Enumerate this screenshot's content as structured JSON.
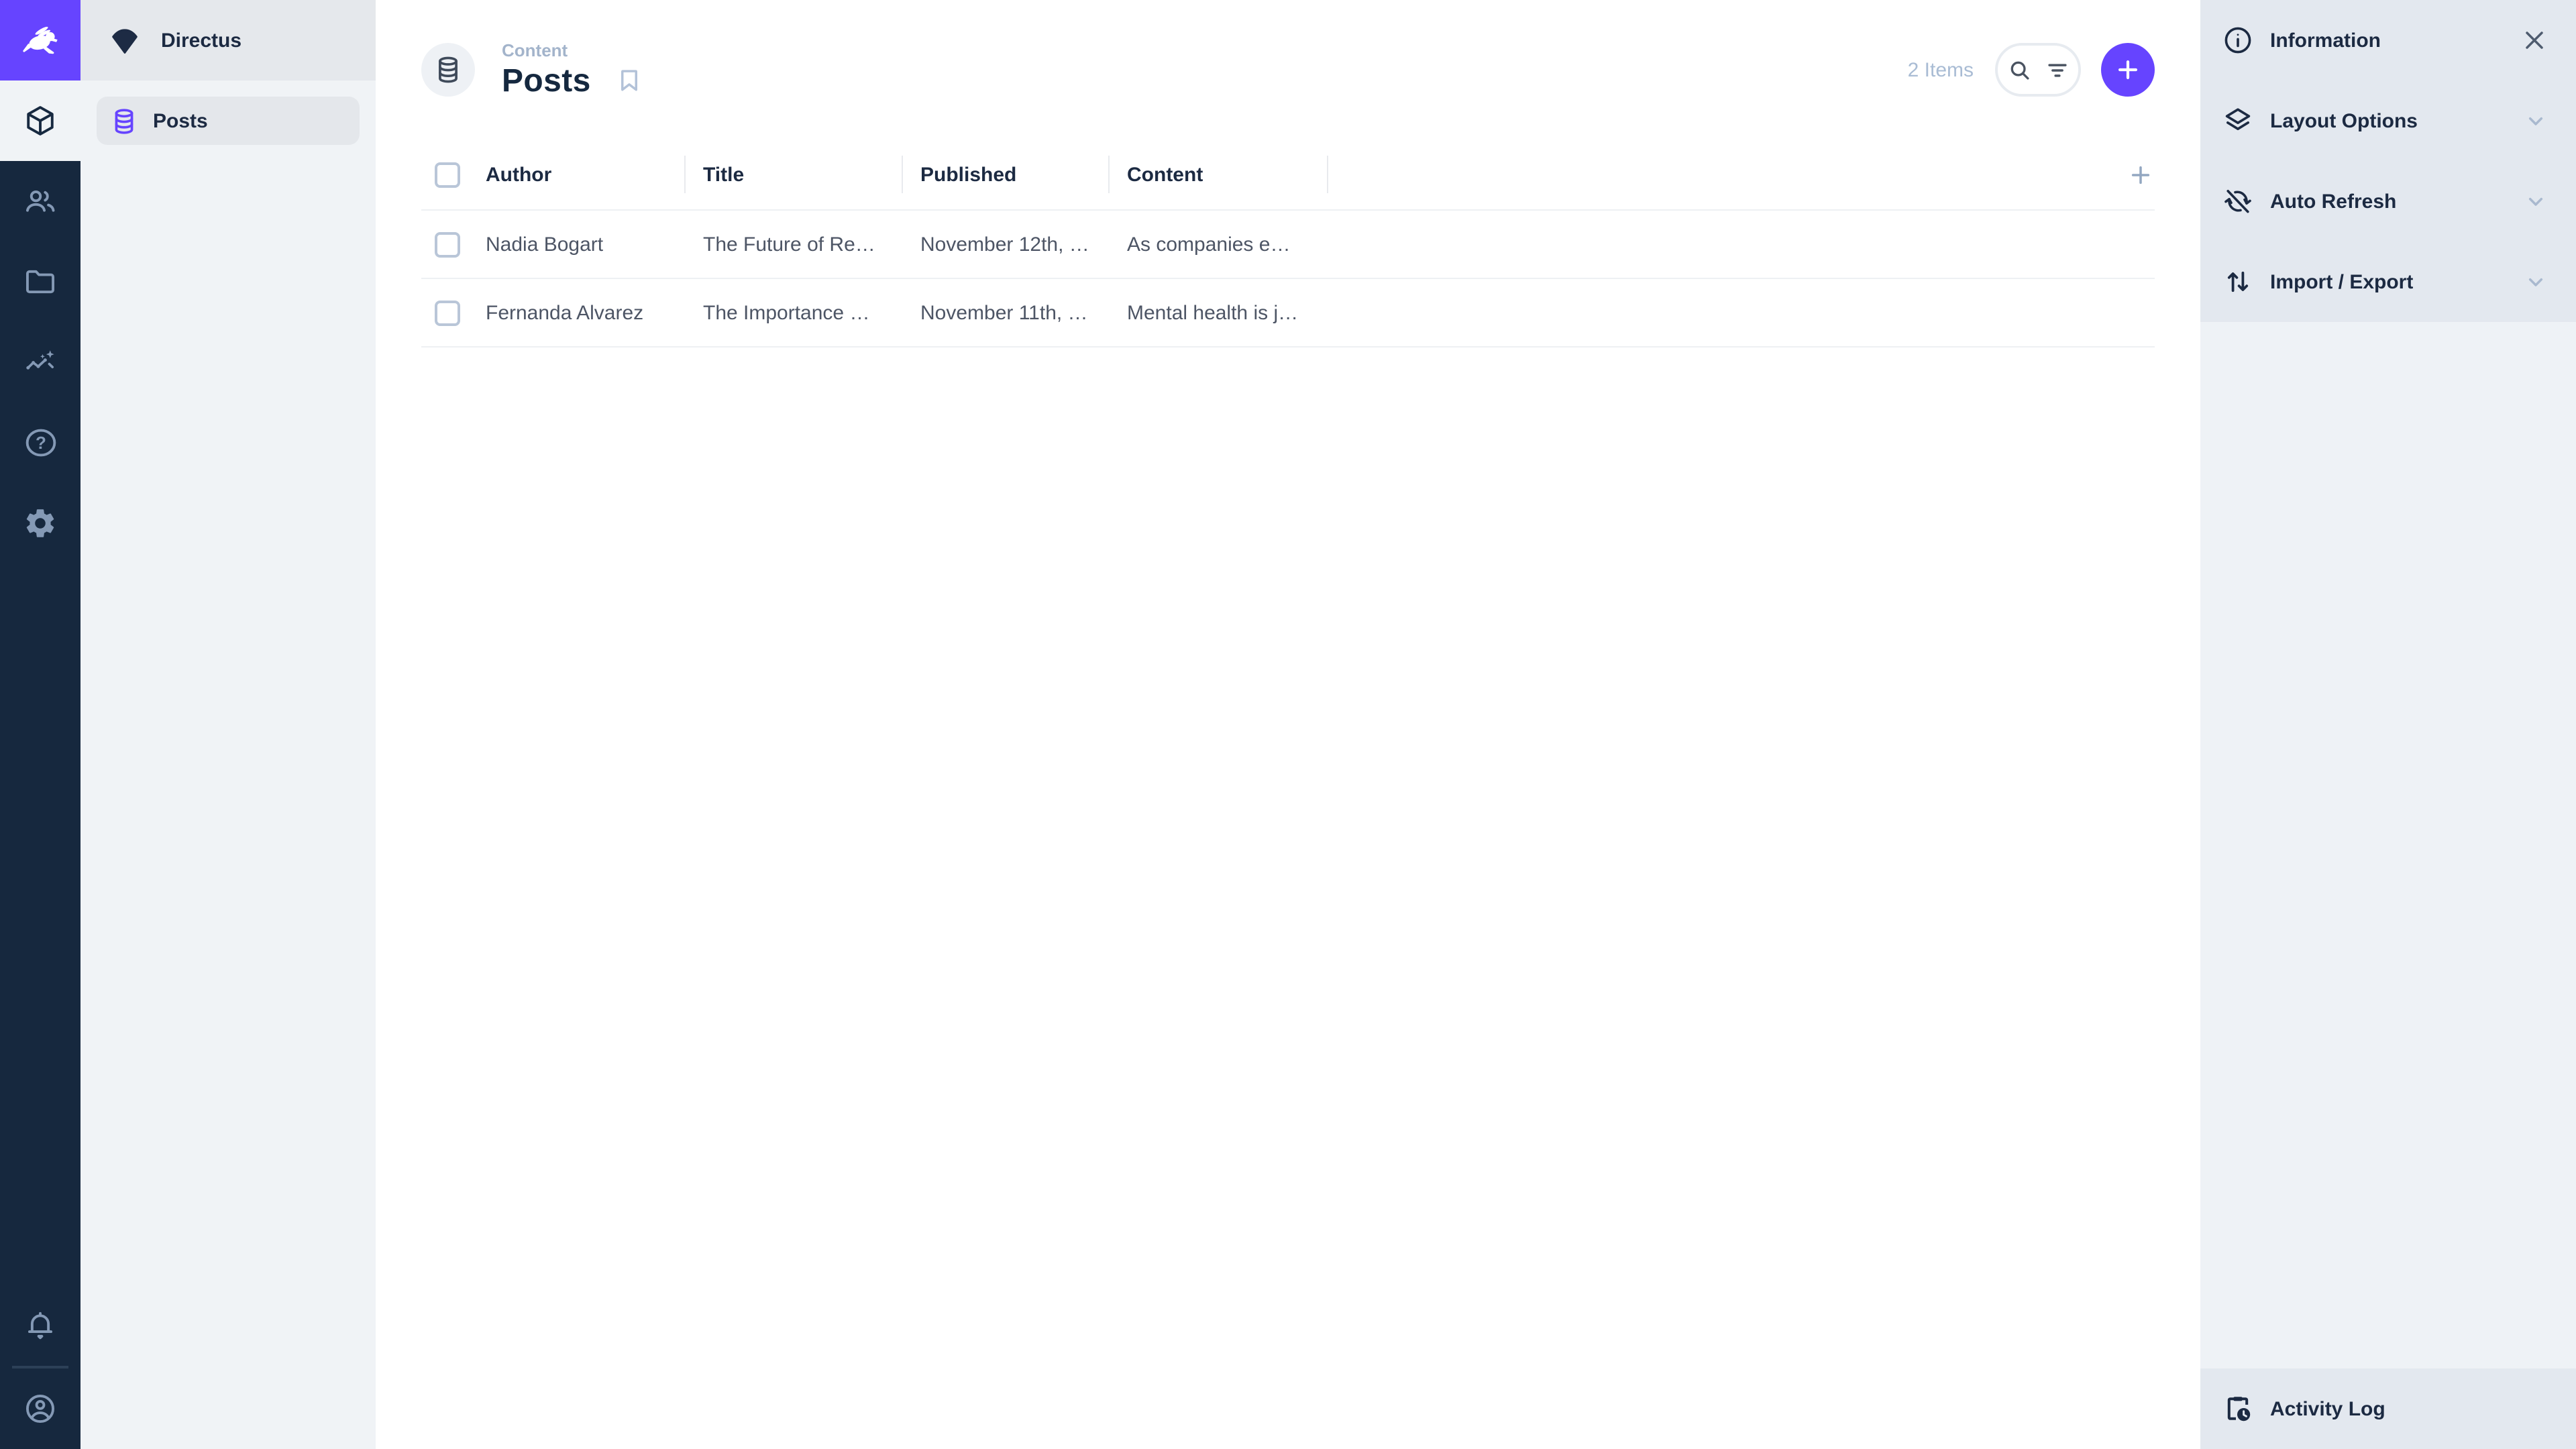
{
  "colors": {
    "brand_purple": "#6644ff",
    "module_bar_bg": "#16283e",
    "module_icon": "#8499b5",
    "nav_bg": "#f0f3f6",
    "nav_header_bg": "#e5e8ec",
    "nav_active_item_bg": "#e4e7eb",
    "sidebar_bg": "#eef2f6",
    "sidebar_section_bg": "#e3e8ef",
    "text_dark": "#1c2a42",
    "text_row": "#4d5565",
    "text_muted": "#a9bcd4",
    "row_divider": "#eef0f3"
  },
  "module_bar": {
    "logo_icon": "rabbit-logo",
    "modules": [
      {
        "name": "content",
        "icon": "box-icon",
        "active": true
      },
      {
        "name": "user-directory",
        "icon": "people-icon",
        "active": false
      },
      {
        "name": "file-library",
        "icon": "folder-icon",
        "active": false
      },
      {
        "name": "insights",
        "icon": "insights-icon",
        "active": false
      },
      {
        "name": "help",
        "icon": "help-icon",
        "active": false
      },
      {
        "name": "settings",
        "icon": "gear-icon",
        "active": false
      }
    ],
    "bottom": [
      {
        "name": "notifications",
        "icon": "bell-icon"
      },
      {
        "name": "account",
        "icon": "account-circle-icon"
      }
    ]
  },
  "nav": {
    "project_name": "Directus",
    "project_icon": "fan-icon",
    "items": [
      {
        "label": "Posts",
        "icon": "database-icon",
        "active": true
      }
    ]
  },
  "header": {
    "breadcrumb": "Content",
    "title": "Posts",
    "collection_icon": "database-icon",
    "bookmark_icon": "bookmark-icon",
    "items_count": "2 Items",
    "search_icon": "search-icon",
    "filter_icon": "filter-icon",
    "add_icon": "plus-icon"
  },
  "table": {
    "columns": [
      {
        "label": "Author"
      },
      {
        "label": "Title"
      },
      {
        "label": "Published"
      },
      {
        "label": "Content"
      }
    ],
    "add_column_icon": "plus-icon",
    "rows": [
      {
        "author": "Nadia Bogart",
        "title": "The Future of Re…",
        "published": "November 12th, …",
        "content": "As companies e…"
      },
      {
        "author": "Fernanda Alvarez",
        "title": "The Importance …",
        "published": "November 11th, …",
        "content": "Mental health is j…"
      }
    ]
  },
  "sidebar": {
    "sections": [
      {
        "label": "Information",
        "icon": "info-icon",
        "control": "close-icon"
      },
      {
        "label": "Layout Options",
        "icon": "layers-icon",
        "control": "chevron-down-icon"
      },
      {
        "label": "Auto Refresh",
        "icon": "sync-disabled-icon",
        "control": "chevron-down-icon"
      },
      {
        "label": "Import / Export",
        "icon": "import-export-icon",
        "control": "chevron-down-icon"
      }
    ],
    "bottom_section": {
      "label": "Activity Log",
      "icon": "activity-log-icon"
    }
  }
}
